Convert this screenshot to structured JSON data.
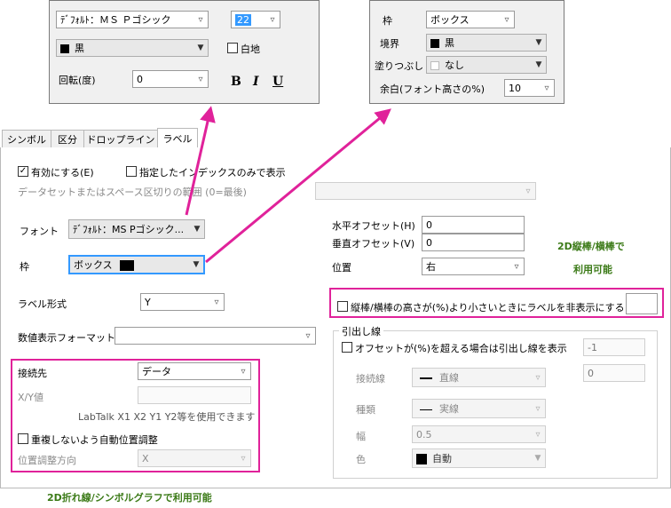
{
  "font_popup": {
    "font_value": "ﾃﾞﾌｫﾙﾄ：ＭＳ Ｐゴシック",
    "size_value": "22",
    "color_value": "黒",
    "color_hex": "#000000",
    "white_bg_label": "白地",
    "rotation_label": "回転(度)",
    "rotation_value": "0",
    "bold": "B",
    "italic": "I",
    "underline": "U"
  },
  "frame_popup": {
    "frame_label": "枠",
    "frame_value": "ボックス",
    "border_label": "境界",
    "border_value": "黒",
    "fill_label": "塗りつぶし",
    "fill_value": "なし",
    "margin_label": "余白(フォント高さの%)",
    "margin_value": "10"
  },
  "tabs": [
    "シンボル",
    "区分",
    "ドロップライン",
    "ラベル"
  ],
  "labels_tab": {
    "enable_label": "有効にする(E)",
    "enable_checked": "✓",
    "specified_index_label": "指定したインデックスのみで表示",
    "dataset_label": "データセットまたはスペース区切りの範囲 (0=最後)",
    "font_label": "フォント",
    "font_value": "ﾃﾞﾌｫﾙﾄ：MS Pゴシック...",
    "frame_label": "枠",
    "frame_value": "ボックス",
    "label_form_label": "ラベル形式",
    "label_form_value": "Y",
    "numeric_format_label": "数値表示フォーマット",
    "numeric_format_value": "",
    "h_offset_label": "水平オフセット(H)",
    "h_offset_value": "0",
    "v_offset_label": "垂直オフセット(V)",
    "v_offset_value": "0",
    "position_label": "位置",
    "position_value": "右",
    "note_bar": "2D縦棒/横棒で",
    "note_bar2": "利用可能",
    "hide_label": "縦棒/横棒の高さが(%)より小さいときにラベルを非表示にする",
    "hide_value": "",
    "connect_label": "接続先",
    "connect_value": "データ",
    "xy_label": "X/Y値",
    "xy_value": "",
    "labtalk_hint": "LabTalk X1 X2 Y1 Y2等を使用できます",
    "auto_pos_label": "重複しないよう自動位置調整",
    "pos_dir_label": "位置調整方向",
    "pos_dir_value": "X",
    "leader_group": "引出し線",
    "leader_chk_label": "オフセットが(%)を超える場合は引出し線を表示",
    "leader_value1": "-1",
    "leader_value2": "0",
    "conn_line_label": "接続線",
    "conn_line_value": "直線",
    "kind_label": "種類",
    "kind_value": "実線",
    "width_label": "幅",
    "width_value": "0.5",
    "color_label": "色",
    "color_value": "自動",
    "note_line": "2D折れ線/シンボルグラフで利用可能"
  },
  "colors": {
    "highlight": "#e0229a",
    "note_green": "#3b7a17"
  }
}
